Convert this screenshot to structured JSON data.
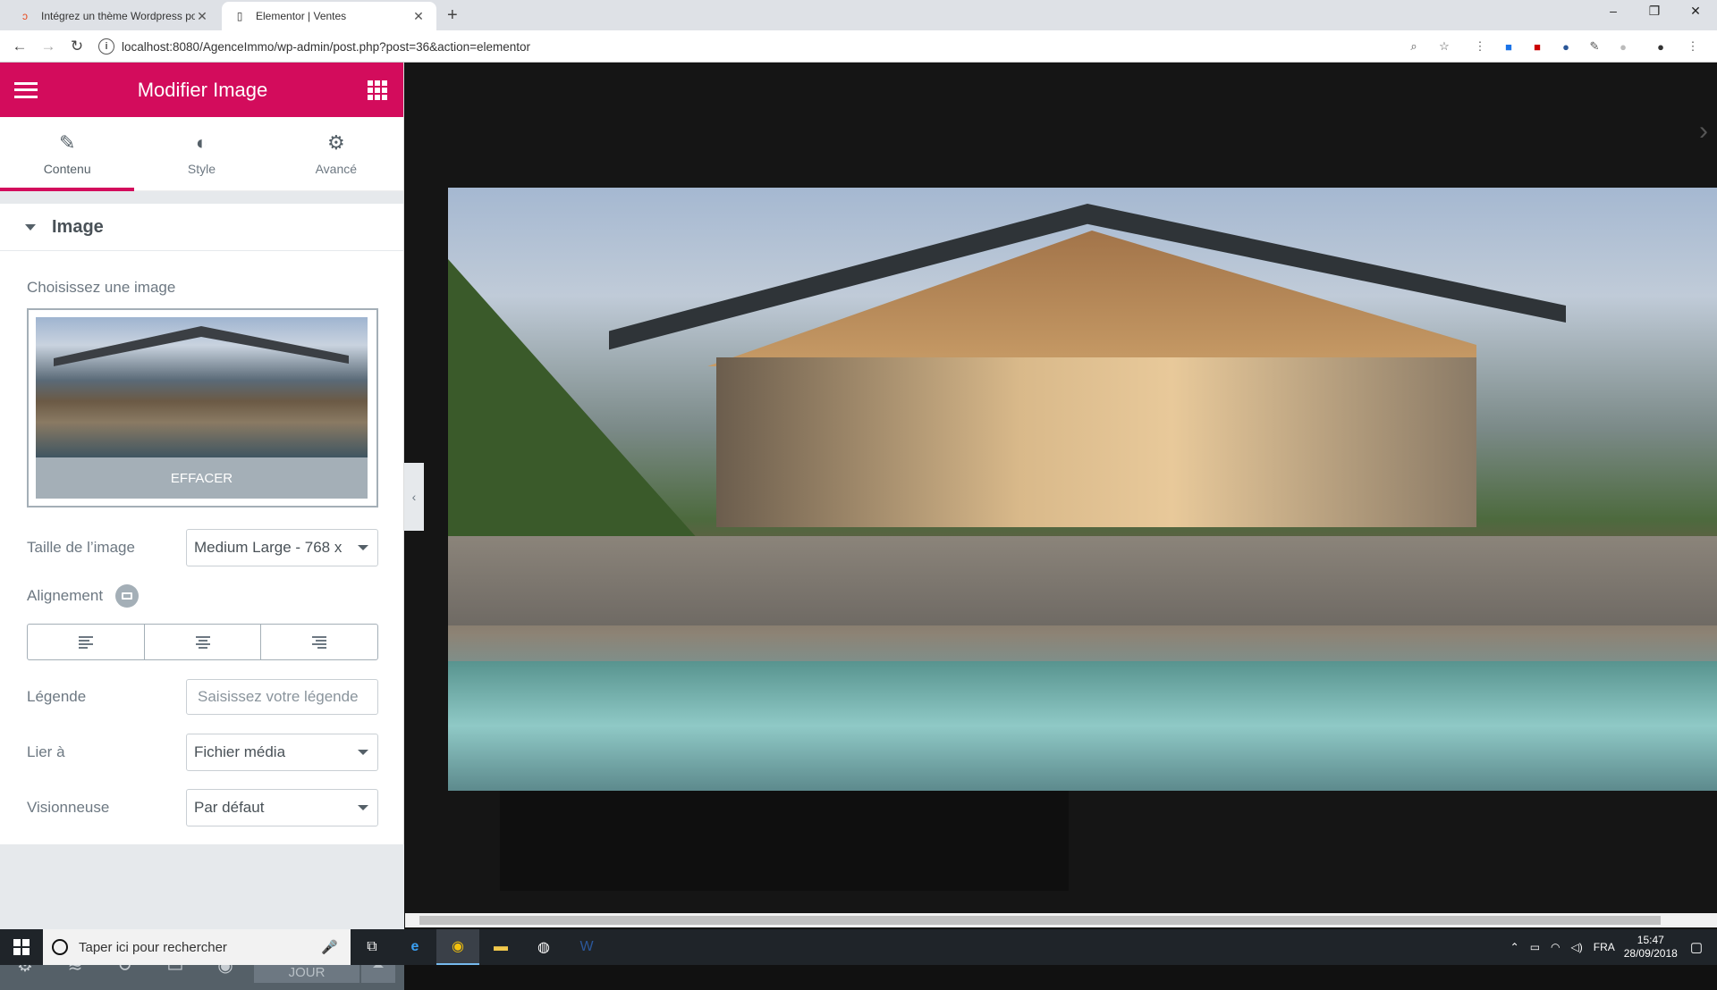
{
  "browser": {
    "tabs": [
      {
        "title": "Intégrez un thème Wordpress po",
        "active": false
      },
      {
        "title": "Elementor | Ventes",
        "active": true
      }
    ],
    "url": "localhost:8080/AgenceImmo/wp-admin/post.php?post=36&action=elementor",
    "controls": {
      "minimize": "–",
      "maximize": "❐",
      "close": "✕",
      "new_tab": "+"
    }
  },
  "panel": {
    "title": "Modifier Image",
    "tabs": [
      {
        "label": "Contenu",
        "icon": "pencil-icon",
        "active": true
      },
      {
        "label": "Style",
        "icon": "contrast-icon",
        "active": false
      },
      {
        "label": "Avancé",
        "icon": "gear-icon",
        "active": false
      }
    ],
    "section": "Image",
    "choose_label": "Choisissez une image",
    "clear_button": "EFFACER",
    "image_size": {
      "label": "Taille de l’image",
      "value": "Medium Large - 768 x"
    },
    "alignment": {
      "label": "Alignement"
    },
    "caption": {
      "label": "Légende",
      "placeholder": "Saisissez votre légende"
    },
    "link": {
      "label": "Lier à",
      "value": "Fichier média"
    },
    "lightbox": {
      "label": "Visionneuse",
      "value": "Par défaut"
    },
    "footer": {
      "update": "METTRE À JOUR"
    }
  },
  "taskbar": {
    "search_placeholder": "Taper ici pour rechercher",
    "language": "FRA",
    "time": "15:47",
    "date": "28/09/2018"
  },
  "colors": {
    "accent": "#d30c5c",
    "panel_footer": "#556068"
  }
}
